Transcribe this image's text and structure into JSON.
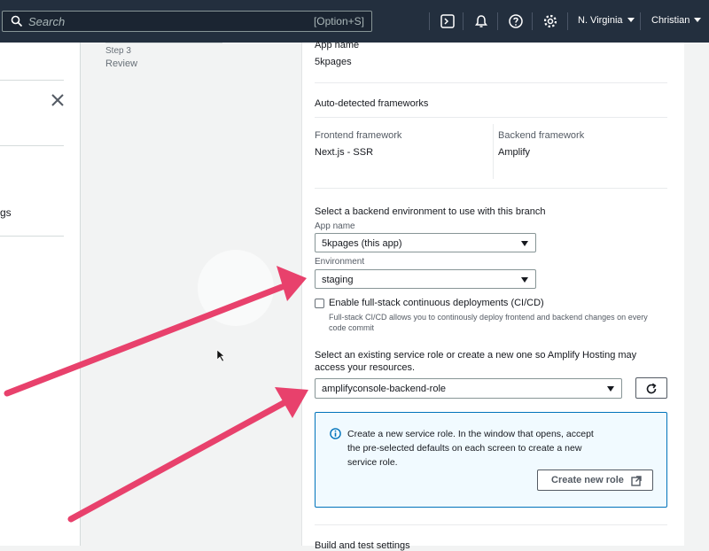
{
  "topbar": {
    "search_placeholder": "Search",
    "search_shortcut": "[Option+S]",
    "region": "N. Virginia",
    "user": "Christian"
  },
  "leftnav": {
    "fragment": "gs"
  },
  "steps": {
    "step_number": "Step 3",
    "step_name": "Review"
  },
  "review": {
    "app_name_label": "App name",
    "app_name_value": "5kpages",
    "frameworks_heading": "Auto-detected frameworks",
    "frontend_label": "Frontend framework",
    "frontend_value": "Next.js - SSR",
    "backend_label": "Backend framework",
    "backend_value": "Amplify",
    "backend_env_heading": "Select a backend environment to use with this branch",
    "backend_app_label": "App name",
    "backend_app_value": "5kpages (this app)",
    "environment_label": "Environment",
    "environment_value": "staging",
    "cicd_label": "Enable full-stack continuous deployments (CI/CD)",
    "cicd_checked": false,
    "cicd_desc": "Full-stack CI/CD allows you to continously deploy frontend and backend changes on every code commit",
    "service_role_intro": "Select an existing service role or create a new one so Amplify Hosting may access your resources.",
    "service_role_value": "amplifyconsole-backend-role",
    "info_text": "Create a new service role. In the window that opens, accept the pre-selected defaults on each screen to create a new service role.",
    "create_role_button": "Create new role",
    "cut_off_text": "Build and test settings"
  },
  "colors": {
    "topbar": "#232f3e",
    "annotation_arrow": "#e8416c",
    "info_border": "#0073bb",
    "info_bg": "#f1faff"
  },
  "icons": [
    "search-icon",
    "cloudshell-icon",
    "bell-icon",
    "help-icon",
    "gear-icon",
    "close-icon",
    "caret-down-icon",
    "refresh-icon",
    "info-icon",
    "external-link-icon",
    "arrow-annotation",
    "mouse-cursor-icon"
  ]
}
